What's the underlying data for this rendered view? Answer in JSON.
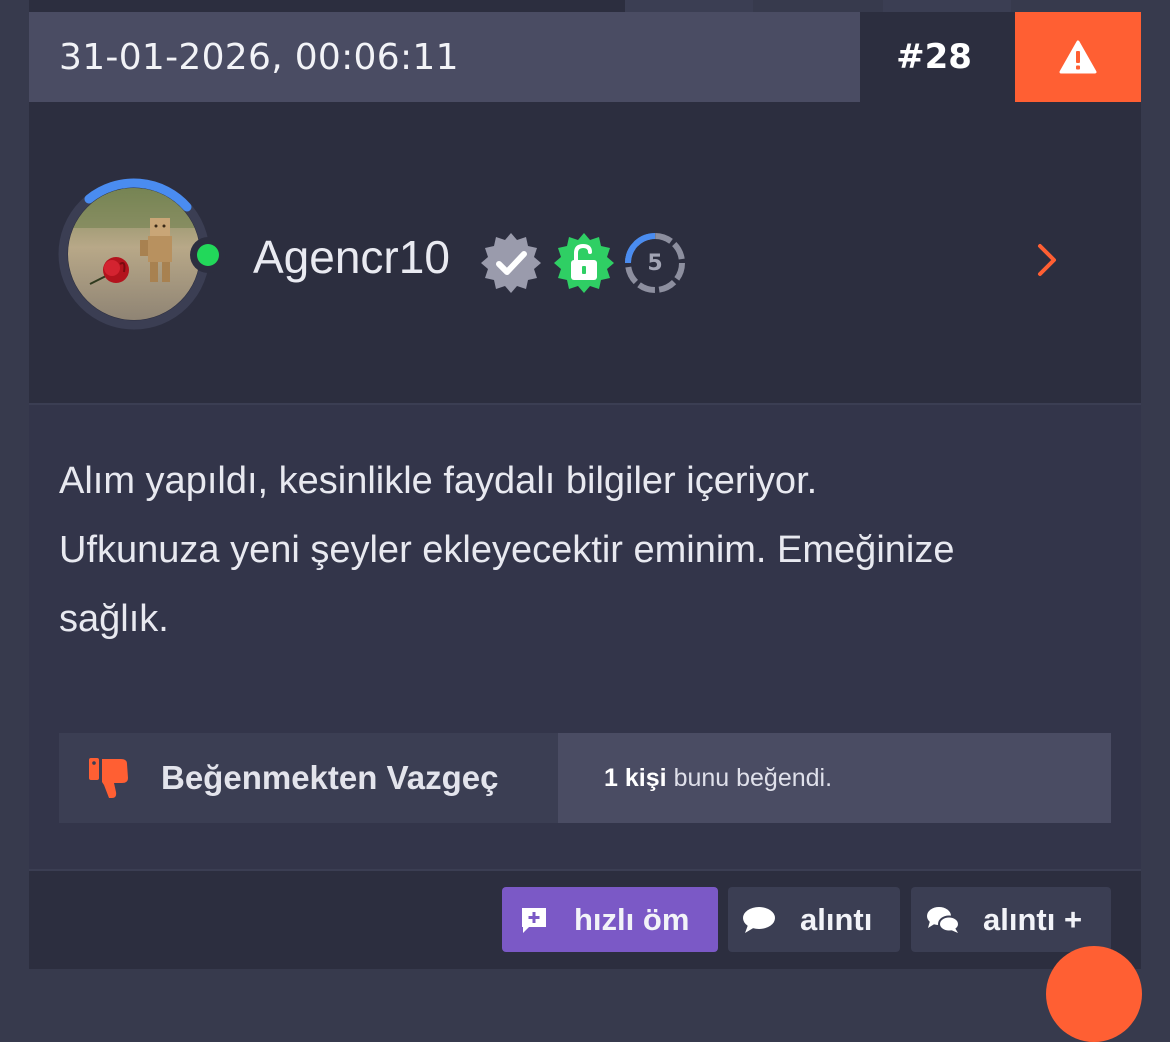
{
  "post": {
    "date": "31-01-2026, 00:06:11",
    "number": "#28",
    "report_icon": "warning-triangle-icon",
    "user": {
      "name": "Agencr10",
      "badges": [
        "verified-check-badge-icon",
        "unlocked-padlock-badge-icon"
      ],
      "level": "5",
      "status": "online"
    },
    "message_lines": [
      "Alım yapıldı, kesinlikle faydalı bilgiler içeriyor.",
      "Ufkunuza yeni şeyler ekleyecektir eminim. Emeğinize",
      "sağlık."
    ],
    "like": {
      "button_label": "Beğenmekten Vazgeç",
      "count_text": "1 kişi",
      "info_text": "bunu beğendi."
    },
    "actions": {
      "quick_reply": "hızlı öm",
      "quote": "alıntı",
      "multi_quote": "alıntı +"
    }
  },
  "colors": {
    "accent": "#ff5f33",
    "purple": "#7b59c6",
    "online": "#22d85a",
    "verified": "#9a9bac",
    "unlock_badge": "#2fcf64",
    "level_ring": "#4a8cf0"
  }
}
